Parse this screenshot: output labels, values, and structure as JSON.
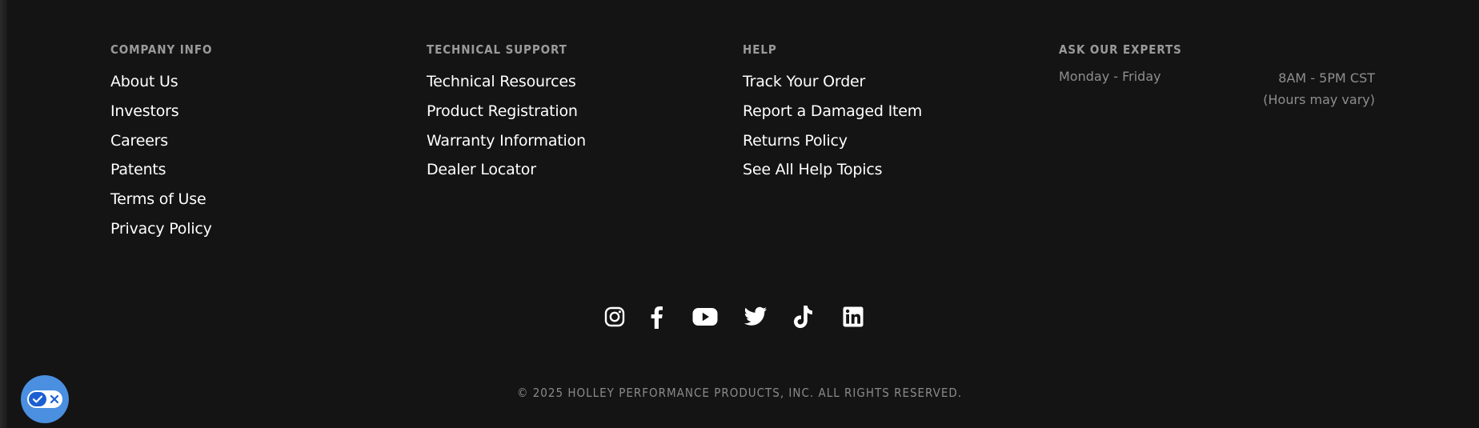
{
  "columns": [
    {
      "heading": "COMPANY INFO",
      "links": [
        "About Us",
        "Investors",
        "Careers",
        "Patents",
        "Terms of Use",
        "Privacy Policy"
      ]
    },
    {
      "heading": "TECHNICAL SUPPORT",
      "links": [
        "Technical Resources",
        "Product Registration",
        "Warranty Information",
        "Dealer Locator"
      ]
    },
    {
      "heading": "HELP",
      "links": [
        "Track Your Order",
        "Report a Damaged Item",
        "Returns Policy",
        "See All Help Topics"
      ]
    }
  ],
  "experts": {
    "heading": "ASK OUR EXPERTS",
    "days": "Monday - Friday",
    "hours": "8AM - 5PM CST",
    "note": "(Hours may vary)"
  },
  "social": [
    {
      "icon": "instagram-icon"
    },
    {
      "icon": "facebook-icon"
    },
    {
      "icon": "youtube-icon"
    },
    {
      "icon": "twitter-icon"
    },
    {
      "icon": "tiktok-icon"
    },
    {
      "icon": "linkedin-icon"
    }
  ],
  "copyright": "© 2025 HOLLEY PERFORMANCE PRODUCTS, INC. ALL RIGHTS RESERVED.",
  "colors": {
    "background": "#141414",
    "heading": "#9a9a9a",
    "link": "#ffffff",
    "muted": "#8e8e8e",
    "accessibility_button": "#4a8fe0"
  }
}
